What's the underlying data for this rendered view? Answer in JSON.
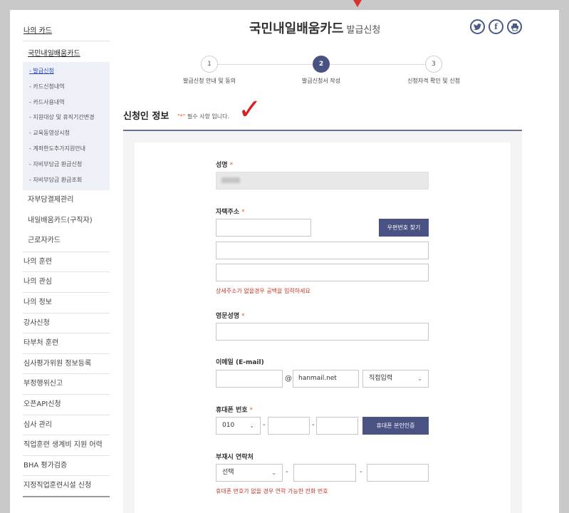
{
  "sidebar": {
    "top": "나의 카드",
    "sub": "국민내일배움카드",
    "leaves": [
      "- 발급신청",
      "- 카드신청내역",
      "- 카드사용내역",
      "- 지원대상 및 휴직기간변경",
      "- 교육동영상시청",
      "- 계좌한도추가지원안내",
      "- 자비부담금 환급신청",
      "- 자비부담금 환급조회"
    ],
    "sections": [
      "자부담결제관리",
      "내일배움카드(구직자)",
      "근로자카드"
    ],
    "mains": [
      "나의 훈련",
      "나의 관심",
      "나의 정보",
      "강사신청",
      "타부처 훈련",
      "심사평가위원 정보등록",
      "부정행위신고",
      "오픈API신청",
      "심사 관리",
      "직업훈련 생계비 지원 어력",
      "BHA 평가검증",
      "지정직업훈련시설 신청"
    ]
  },
  "header": {
    "title": "국민내일배움카드",
    "subtitle": "발급신청",
    "social": [
      "twitter-icon",
      "facebook-icon",
      "print-icon"
    ]
  },
  "steps": [
    {
      "num": "1",
      "label": "발급신청 안내 및 동의"
    },
    {
      "num": "2",
      "label": "발급신청서 작성"
    },
    {
      "num": "3",
      "label": "신청자격 확인 및 신청"
    }
  ],
  "section": {
    "title": "신청인 정보",
    "req_star": "\"*\"",
    "req_note": " 필수 사항 입니다."
  },
  "form": {
    "name_label": "성명",
    "address_label": "자택주소",
    "postcode_button": "우편번호 찾기",
    "address_help": "상세주소가 없을경우 공백을 입력하세요",
    "eng_name_label": "영문성명",
    "email_label": "이메일 (E-mail)",
    "email_at": "@",
    "email_domain": "hanmail.net",
    "email_select": "직접입력",
    "phone_label": "휴대폰 번호",
    "phone_prefix": "010",
    "phone_dash": "-",
    "verify_button": "휴대폰 본인인증",
    "absence_label": "부재시 연락처",
    "absence_select": "선택",
    "absence_help": "휴대폰 번호가 없을 경우 연락 가능한 전화 번호",
    "star": "*"
  },
  "colors": {
    "accent": "#4a5284",
    "required": "#e0602a",
    "help": "#c0392b"
  }
}
